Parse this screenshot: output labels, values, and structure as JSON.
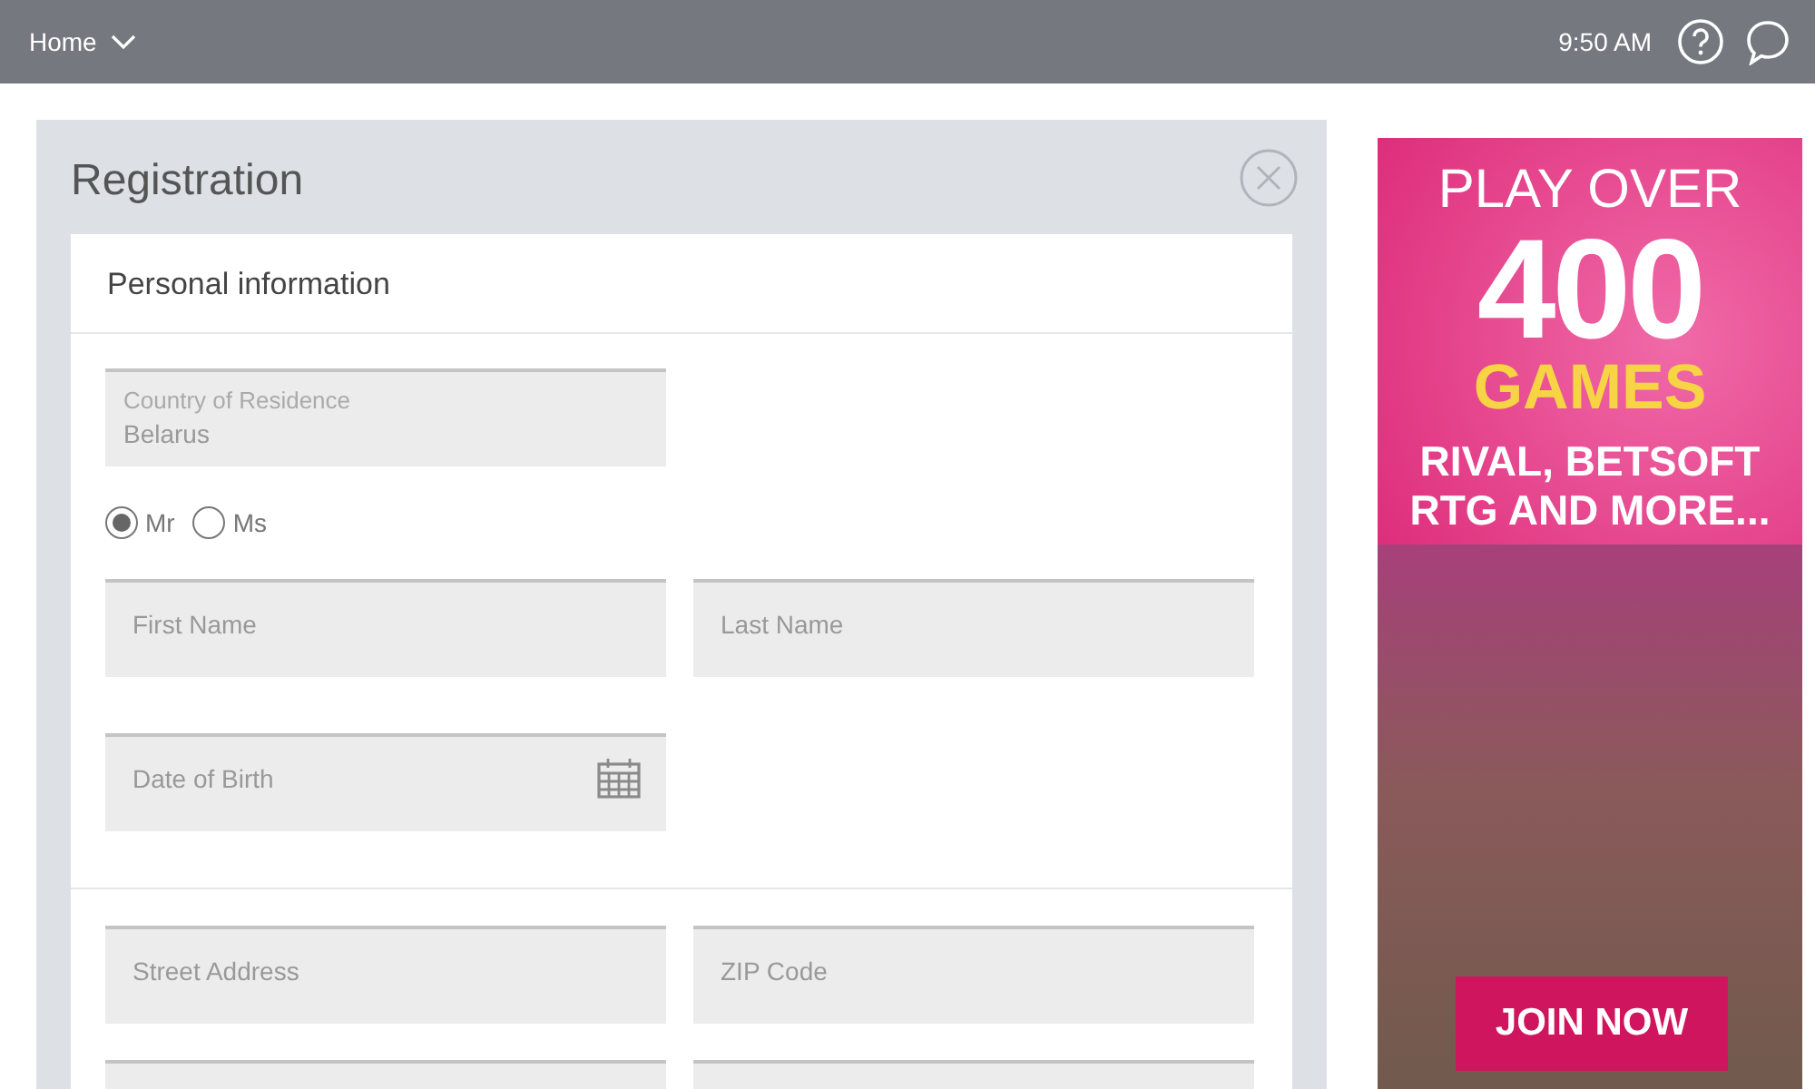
{
  "top_bar": {
    "menu": "Home",
    "time": "9:50 AM"
  },
  "registration": {
    "title": "Registration",
    "sections": [
      {
        "title": "Personal information",
        "rows": [
          {
            "kind": "select",
            "fields": [
              {
                "label": "Country of Residence",
                "value": "Belarus"
              }
            ]
          },
          {
            "kind": "radio",
            "options": [
              {
                "label": "Mr",
                "selected": true
              },
              {
                "label": "Ms",
                "selected": false
              }
            ]
          },
          {
            "kind": "fields",
            "fields": [
              {
                "placeholder": "First Name"
              },
              {
                "placeholder": "Last Name"
              }
            ]
          },
          {
            "kind": "fields",
            "fields": [
              {
                "placeholder": "Date of Birth",
                "kind": "date"
              }
            ]
          }
        ]
      },
      {
        "rows": [
          {
            "kind": "fields",
            "fields": [
              {
                "placeholder": "Street Address"
              },
              {
                "placeholder": "ZIP Code"
              }
            ]
          },
          {
            "kind": "fields",
            "fields": [
              {
                "kind": "text"
              },
              {
                "kind": "text"
              }
            ]
          }
        ]
      }
    ]
  },
  "ad": {
    "lines": [
      "PLAY OVER",
      "400",
      "GAMES",
      "RIVAL, BETSOFT",
      "RTG AND MORE..."
    ],
    "button": "JOIN NOW"
  }
}
